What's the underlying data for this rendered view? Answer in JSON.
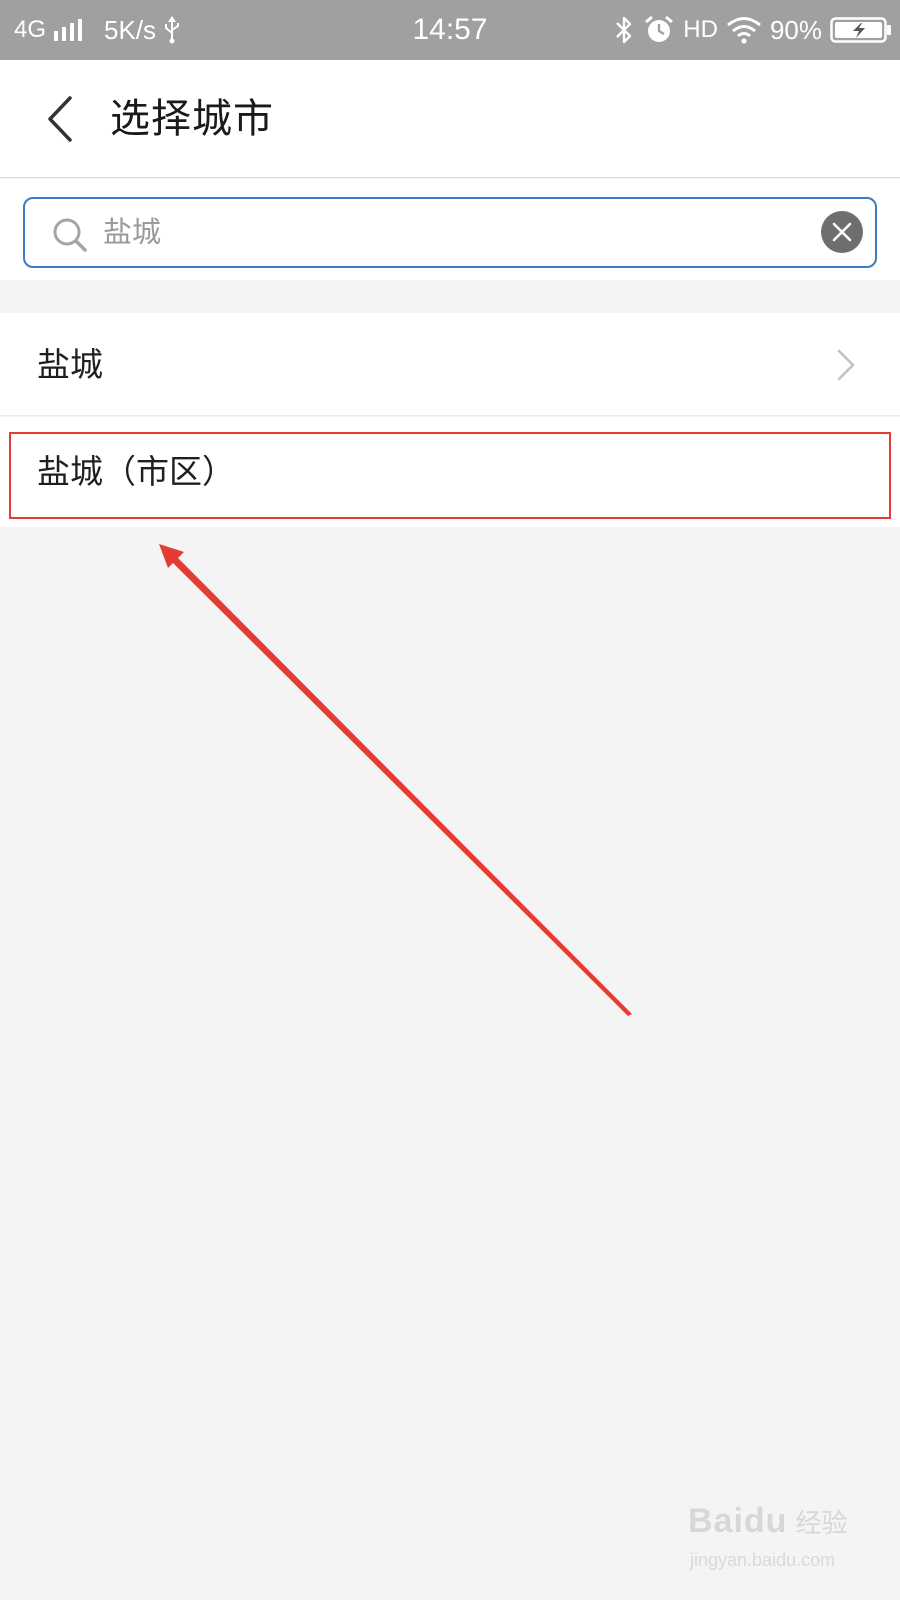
{
  "status_bar": {
    "network": "4G",
    "speed": "5K/s",
    "time": "14:57",
    "hd": "HD",
    "battery": "90%",
    "icons": [
      "signal-icon",
      "usb-icon",
      "bluetooth-icon",
      "alarm-icon",
      "wifi-icon",
      "battery-charging-icon"
    ]
  },
  "header": {
    "title": "选择城市",
    "back_icon": "chevron-left-icon"
  },
  "search": {
    "value": "盐城",
    "search_icon": "search-icon",
    "clear_icon": "clear-icon"
  },
  "results": [
    {
      "label": "盐城",
      "has_chevron": true
    },
    {
      "label": "盐城（市区）",
      "has_chevron": false
    }
  ],
  "annotation": {
    "highlight_color": "#e53b33",
    "arrow_color": "#e53b33"
  },
  "watermark": {
    "brand_letters": "Baidu",
    "brand_cn": "经验",
    "url": "jingyan.baidu.com"
  },
  "colors": {
    "status_bar_bg": "#a0a0a0",
    "search_border": "#3b7cc4",
    "page_bg": "#f4f4f5"
  }
}
